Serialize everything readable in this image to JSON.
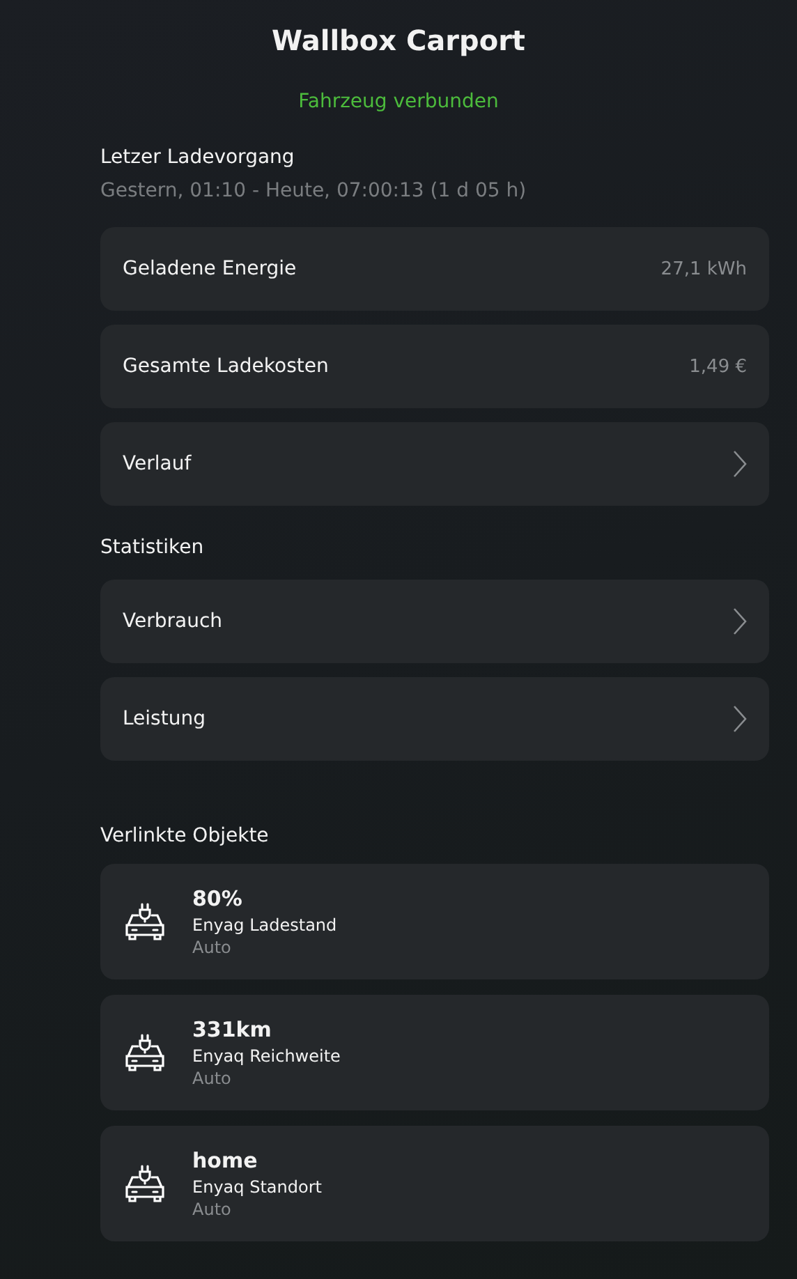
{
  "title": "Wallbox Carport",
  "status": {
    "text": "Fahrzeug verbunden",
    "color": "#4cbb3c"
  },
  "last_charge": {
    "heading": "Letzer Ladevorgang",
    "period": "Gestern, 01:10 - Heute, 07:00:13 (1 d 05 h)"
  },
  "charge_rows": [
    {
      "kind": "value",
      "label": "Geladene Energie",
      "value": "27,1 kWh"
    },
    {
      "kind": "value",
      "label": "Gesamte Ladekosten",
      "value": "1,49 €"
    },
    {
      "kind": "link",
      "label": "Verlauf"
    }
  ],
  "statistics": {
    "heading": "Statistiken",
    "rows": [
      {
        "kind": "link",
        "label": "Verbrauch"
      },
      {
        "kind": "link",
        "label": "Leistung"
      }
    ]
  },
  "linked_objects": {
    "heading": "Verlinkte Objekte",
    "items": [
      {
        "value": "80%",
        "name": "Enyag Ladestand",
        "type": "Auto"
      },
      {
        "value": "331km",
        "name": "Enyaq Reichweite",
        "type": "Auto"
      },
      {
        "value": "home",
        "name": "Enyaq Standort",
        "type": "Auto"
      }
    ]
  }
}
